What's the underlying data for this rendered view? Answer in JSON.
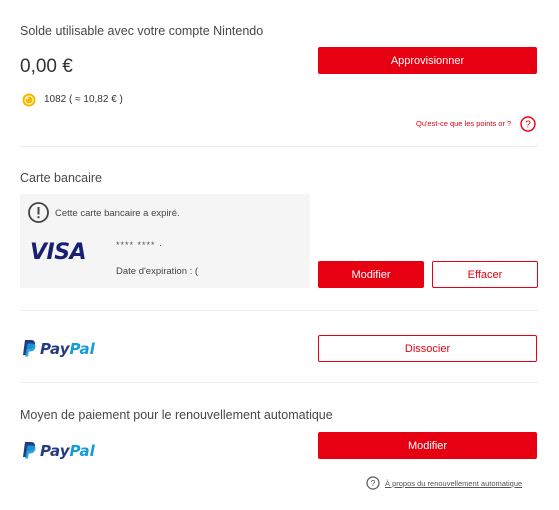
{
  "balance": {
    "title": "Solde utilisable avec votre compte Nintendo",
    "amount": "0,00 €",
    "topup_button": "Approvisionner",
    "points_value": "1082",
    "points_equiv": "( ≈ 10,82 € )",
    "points_help_link": "Qu'est-ce que les points or ?"
  },
  "card": {
    "title": "Carte bancaire",
    "expired_message": "Cette carte bancaire a expiré.",
    "brand": "VISA",
    "number": "**** **** ·",
    "expiry_label": "Date d'expiration : (",
    "modify_button": "Modifier",
    "delete_button": "Effacer"
  },
  "paypal": {
    "logo_pay": "Pay",
    "logo_pal": "Pal",
    "dissociate_button": "Dissocier"
  },
  "auto_renewal": {
    "title": "Moyen de paiement pour le renouvellement automatique",
    "logo_pay": "Pay",
    "logo_pal": "Pal",
    "modify_button": "Modifier",
    "about_link": "À propos du renouvellement automatique"
  },
  "colors": {
    "accent": "#e60012",
    "paypal_dark": "#253b80",
    "paypal_light": "#179bd7",
    "coin": "#f5b800"
  }
}
